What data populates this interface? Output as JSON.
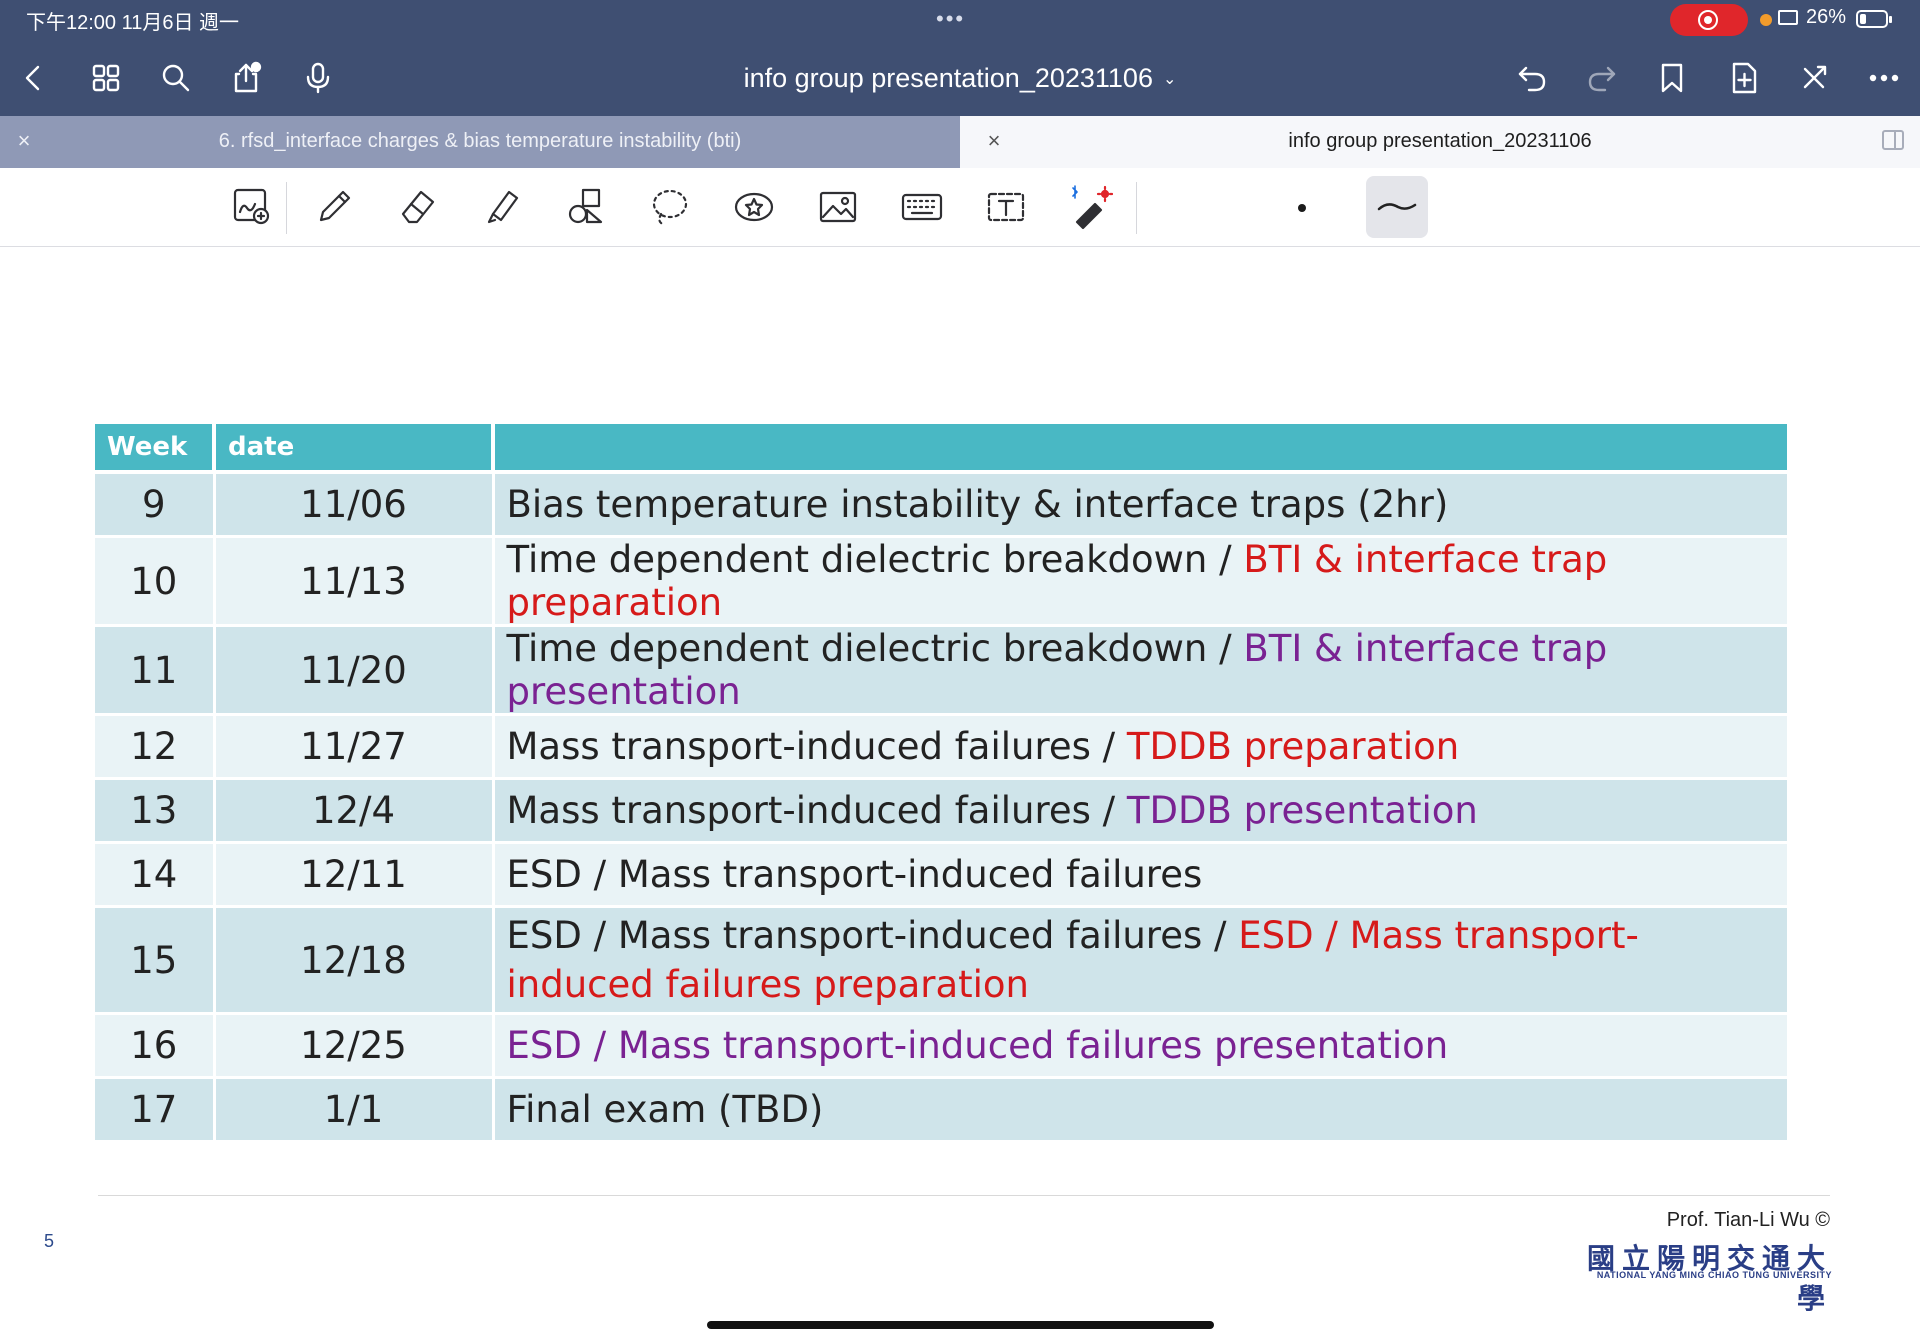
{
  "status_bar": {
    "time": "下午12:00   11月6日 週一",
    "dots": "•••",
    "battery": "26%",
    "battery_level": 0.26
  },
  "navbar": {
    "title": "info group presentation_20231106",
    "title_chevron": "⌄",
    "left_icons": [
      "back-icon",
      "grid-icon",
      "search-icon",
      "share-icon",
      "microphone-icon"
    ],
    "right_icons": [
      "undo-icon",
      "redo-icon",
      "bookmark-icon",
      "add-page-icon",
      "close-icon",
      "more-icon"
    ]
  },
  "tabs": [
    {
      "label": "6. rfsd_interface charges & bias temperature instability (bti)",
      "close": "×",
      "active": false
    },
    {
      "label": "info group presentation_20231106",
      "close": "×",
      "active": true
    }
  ],
  "tools": [
    "zoom-window-icon",
    "pen-icon",
    "eraser-icon",
    "highlighter-icon",
    "shapes-icon",
    "lasso-icon",
    "sticker-icon",
    "image-icon",
    "keyboard-icon",
    "text-box-icon",
    "laser-pointer-icon"
  ],
  "table": {
    "headers": [
      "Week",
      "date",
      ""
    ],
    "rows": [
      {
        "week": "9",
        "date": "11/06",
        "parts": [
          {
            "text": "Bias temperature instability & interface traps  (2hr)",
            "color": "#222222"
          }
        ]
      },
      {
        "week": "10",
        "date": "11/13",
        "parts": [
          {
            "text": "Time dependent dielectric breakdown / ",
            "color": "#222222"
          },
          {
            "text": "BTI & interface trap preparation",
            "color": "#d61a1a"
          }
        ]
      },
      {
        "week": "11",
        "date": "11/20",
        "parts": [
          {
            "text": "Time dependent dielectric breakdown / ",
            "color": "#222222"
          },
          {
            "text": "BTI & interface trap presentation",
            "color": "#7a2292"
          }
        ]
      },
      {
        "week": "12",
        "date": "11/27",
        "parts": [
          {
            "text": "Mass transport-induced failures / ",
            "color": "#222222"
          },
          {
            "text": "TDDB preparation",
            "color": "#d61a1a"
          }
        ]
      },
      {
        "week": "13",
        "date": "12/4",
        "parts": [
          {
            "text": "Mass transport-induced failures / ",
            "color": "#222222"
          },
          {
            "text": "TDDB presentation",
            "color": "#7a2292"
          }
        ]
      },
      {
        "week": "14",
        "date": "12/11",
        "parts": [
          {
            "text": "ESD / Mass transport-induced failures",
            "color": "#222222"
          }
        ]
      },
      {
        "week": "15",
        "date": "12/18",
        "parts": [
          {
            "text": "ESD / Mass transport-induced failures / ",
            "color": "#222222"
          },
          {
            "text": "ESD / Mass transport-induced failures preparation",
            "color": "#d61a1a"
          }
        ]
      },
      {
        "week": "16",
        "date": "12/25",
        "parts": [
          {
            "text": "ESD / Mass transport-induced failures  presentation",
            "color": "#7a2292"
          }
        ]
      },
      {
        "week": "17",
        "date": "1/1",
        "parts": [
          {
            "text": "Final exam (TBD)",
            "color": "#222222"
          }
        ]
      }
    ]
  },
  "footer": {
    "page_number": "5",
    "author": "Prof. Tian-Li Wu ©",
    "university_cn": "國立陽明交通大學",
    "university_en": "NATIONAL YANG MING CHIAO TUNG UNIVERSITY"
  },
  "colors": {
    "navbar": "#3f4f72",
    "header_teal": "#49b8c4",
    "row_dark": "#cfe4ea",
    "row_light": "#e9f3f6",
    "red": "#d61a1a",
    "purple": "#7a2292"
  }
}
